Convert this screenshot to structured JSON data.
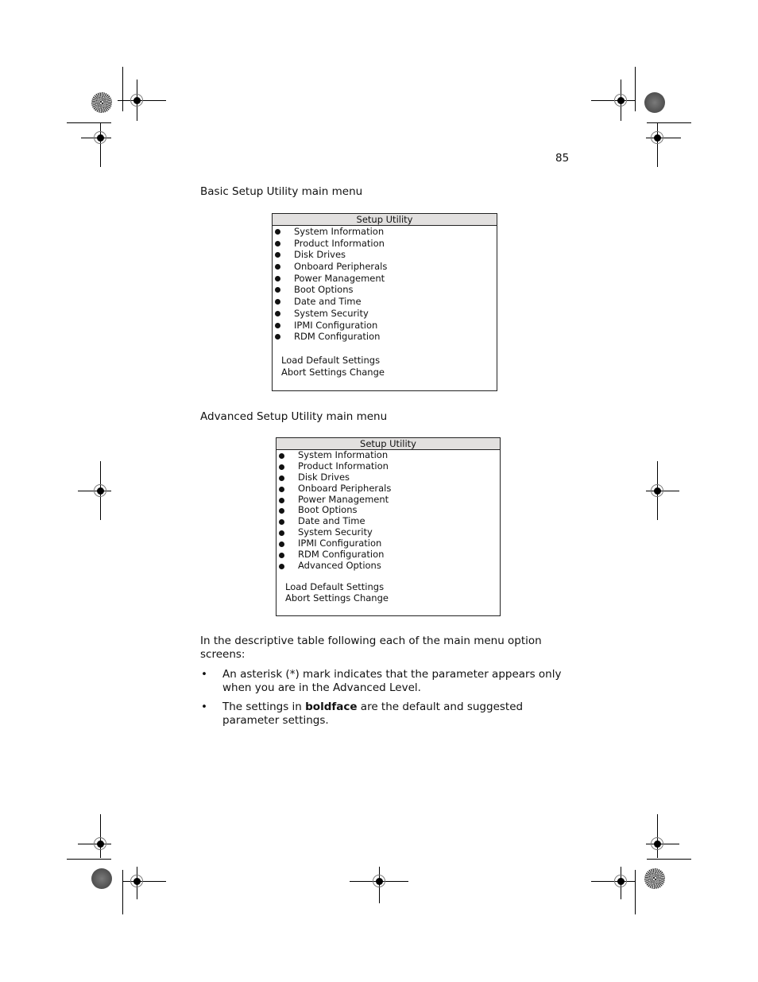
{
  "page": {
    "number": "85"
  },
  "basic_menu": {
    "caption": "Basic Setup Utility main menu",
    "title": "Setup Utility",
    "items": [
      "System Information",
      "Product Information",
      "Disk Drives",
      "Onboard Peripherals",
      "Power Management",
      "Boot Options",
      "Date and Time",
      "System Security",
      "IPMI Configuration",
      "RDM Configuration"
    ],
    "actions": [
      "Load Default Settings",
      "Abort Settings Change"
    ]
  },
  "advanced_menu": {
    "caption": "Advanced Setup Utility main menu",
    "title": "Setup Utility",
    "items": [
      "System Information",
      "Product Information",
      "Disk Drives",
      "Onboard Peripherals",
      "Power Management",
      "Boot Options",
      "Date and Time",
      "System Security",
      "IPMI Configuration",
      "RDM Configuration",
      "Advanced Options"
    ],
    "actions": [
      "Load Default Settings",
      "Abort Settings Change"
    ]
  },
  "notes": {
    "intro": "In the descriptive table following each of the main menu option screens:",
    "bullet_glyph": "•",
    "bullets": [
      {
        "text": "An asterisk (*) mark indicates that the parameter appears only when you are in the Advanced Level."
      },
      {
        "prefix": "The settings in ",
        "bold": "boldface",
        "suffix": " are the default and suggested parameter settings."
      }
    ]
  },
  "print_marks": {
    "registration_icon": "crosshair-target-icon",
    "color_bar_icons": [
      "starburst-disc-icon",
      "gray-disc-icon"
    ]
  }
}
